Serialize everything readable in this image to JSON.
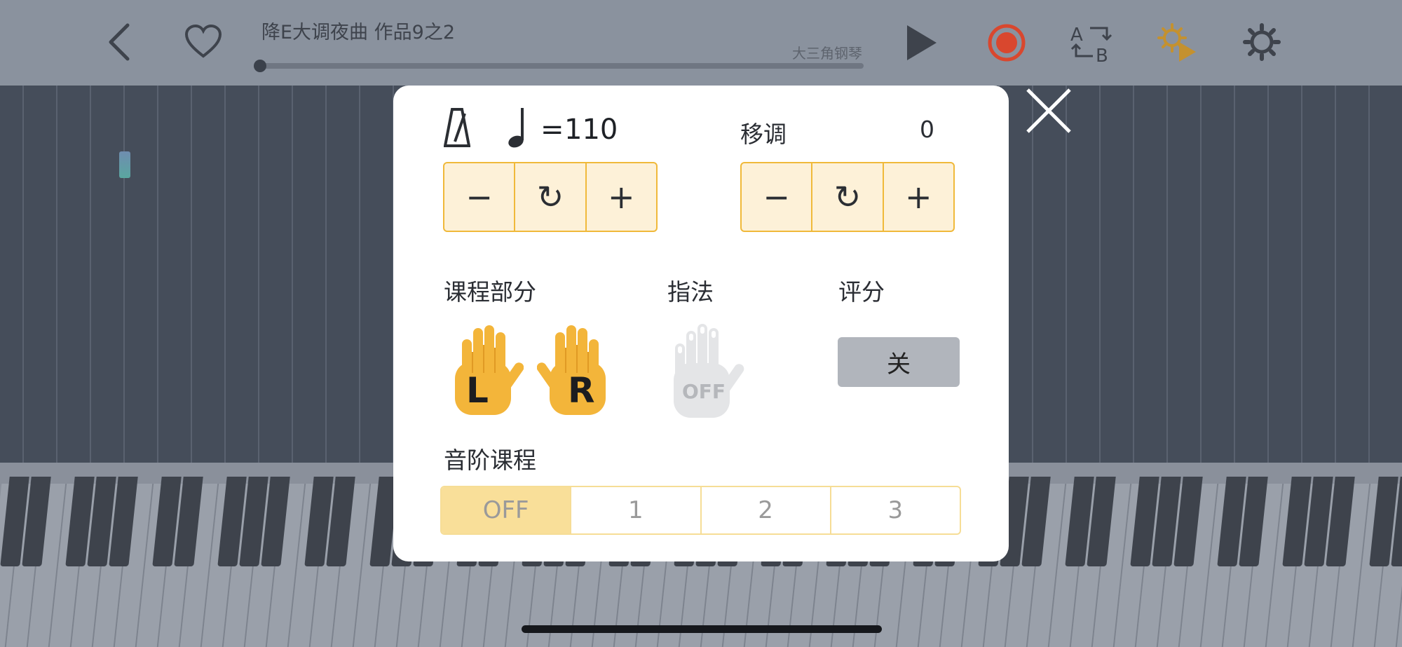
{
  "header": {
    "song_title": "降E大调夜曲 作品9之2",
    "instrument": "大三角钢琴",
    "progress": 0.0
  },
  "icons": {
    "back": "chevron-left-icon",
    "favorite": "heart-icon",
    "play": "play-icon",
    "record": "record-icon",
    "ab_loop": "ab-repeat-icon",
    "auto_play": "gear-play-icon",
    "settings": "gear-icon",
    "close": "close-icon",
    "metronome": "metronome-icon",
    "quarter_note": "quarter-note-icon"
  },
  "tempo": {
    "equals": "=",
    "value": "110",
    "minus": "−",
    "reset": "↻",
    "plus": "+"
  },
  "transpose": {
    "label": "移调",
    "value": "0",
    "minus": "−",
    "reset": "↻",
    "plus": "+"
  },
  "lesson_part": {
    "label": "课程部分",
    "left": "L",
    "right": "R"
  },
  "fingering": {
    "label": "指法",
    "state": "OFF"
  },
  "scoring": {
    "label": "评分",
    "button": "关"
  },
  "scale_lesson": {
    "label": "音阶课程",
    "options": [
      "OFF",
      "1",
      "2",
      "3"
    ],
    "selected": "OFF"
  },
  "colors": {
    "accent": "#f3b53a",
    "stepper_bg": "#fdf1d8",
    "record": "#d9472e",
    "disabled": "#e4e5e7"
  }
}
